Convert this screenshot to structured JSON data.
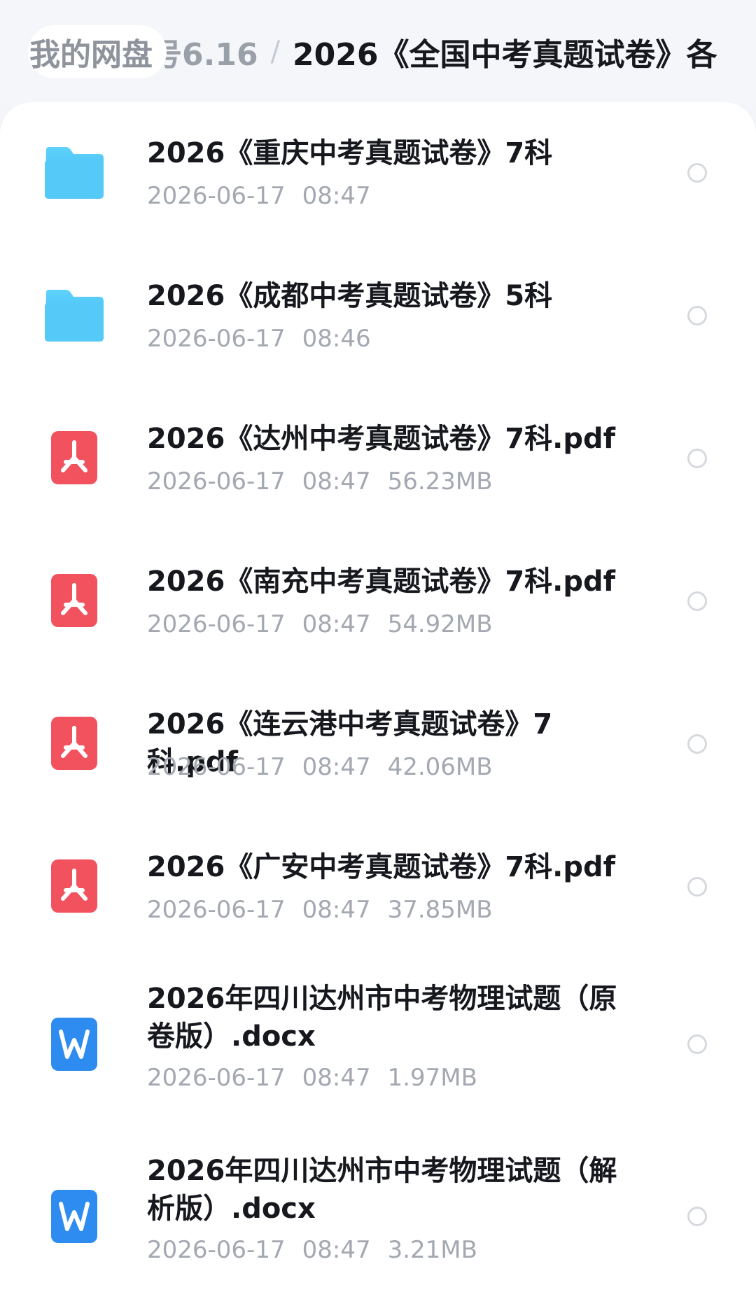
{
  "breadcrumb": {
    "home": "我的网盘",
    "middle": "号6.16",
    "separator": "/",
    "current": "2026《全国中考真题试卷》各"
  },
  "files": [
    {
      "type": "folder",
      "name": "2026《重庆中考真题试卷》7科",
      "date": "2026-06-17",
      "time": "08:47",
      "size": ""
    },
    {
      "type": "folder",
      "name": "2026《成都中考真题试卷》5科",
      "date": "2026-06-17",
      "time": "08:46",
      "size": ""
    },
    {
      "type": "pdf",
      "name": "2026《达州中考真题试卷》7科.pdf",
      "date": "2026-06-17",
      "time": "08:47",
      "size": "56.23MB"
    },
    {
      "type": "pdf",
      "name": "2026《南充中考真题试卷》7科.pdf",
      "date": "2026-06-17",
      "time": "08:47",
      "size": "54.92MB"
    },
    {
      "type": "pdf",
      "name": "2026《连云港中考真题试卷》7科.pdf",
      "date": "2026-06-17",
      "time": "08:47",
      "size": "42.06MB"
    },
    {
      "type": "pdf",
      "name": "2026《广安中考真题试卷》7科.pdf",
      "date": "2026-06-17",
      "time": "08:47",
      "size": "37.85MB"
    },
    {
      "type": "docx",
      "name": "2026年四川达州市中考物理试题（原卷版）.docx",
      "date": "2026-06-17",
      "time": "08:47",
      "size": "1.97MB"
    },
    {
      "type": "docx",
      "name": "2026年四川达州市中考物理试题（解析版）.docx",
      "date": "2026-06-17",
      "time": "08:47",
      "size": "3.21MB"
    }
  ],
  "colors": {
    "folder": "#4fc4f6",
    "pdf": "#f2525e",
    "docx": "#2e8cf0",
    "accent_text": "#16181d",
    "meta_text": "#a3a8b1"
  }
}
